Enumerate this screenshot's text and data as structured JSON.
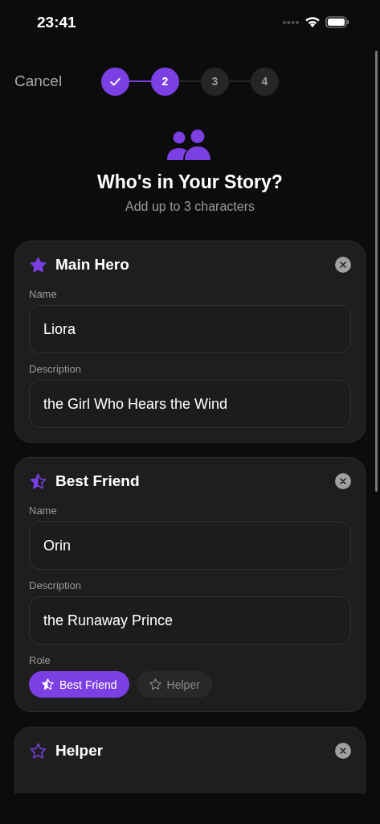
{
  "status_bar": {
    "time": "23:41"
  },
  "nav": {
    "cancel": "Cancel",
    "steps": [
      {
        "kind": "done"
      },
      {
        "label": "2",
        "kind": "current"
      },
      {
        "label": "3",
        "kind": "upcoming"
      },
      {
        "label": "4",
        "kind": "upcoming"
      }
    ]
  },
  "header": {
    "title": "Who's in Your Story?",
    "subtitle": "Add up to 3 characters"
  },
  "cards": [
    {
      "title": "Main Hero",
      "kind": "full",
      "fields": [
        {
          "label": "Name",
          "value": "Liora"
        },
        {
          "label": "Description",
          "value": "the Girl Who Hears the Wind"
        }
      ]
    },
    {
      "title": "Best Friend",
      "kind": "half",
      "fields": [
        {
          "label": "Name",
          "value": "Orin"
        },
        {
          "label": "Description",
          "value": "the Runaway Prince"
        }
      ],
      "role": {
        "label": "Role",
        "options": [
          {
            "label": "Best Friend",
            "kind": "half",
            "selected": true
          },
          {
            "label": "Helper",
            "kind": "outline",
            "selected": false
          }
        ]
      }
    },
    {
      "title": "Helper",
      "kind": "outline"
    }
  ]
}
